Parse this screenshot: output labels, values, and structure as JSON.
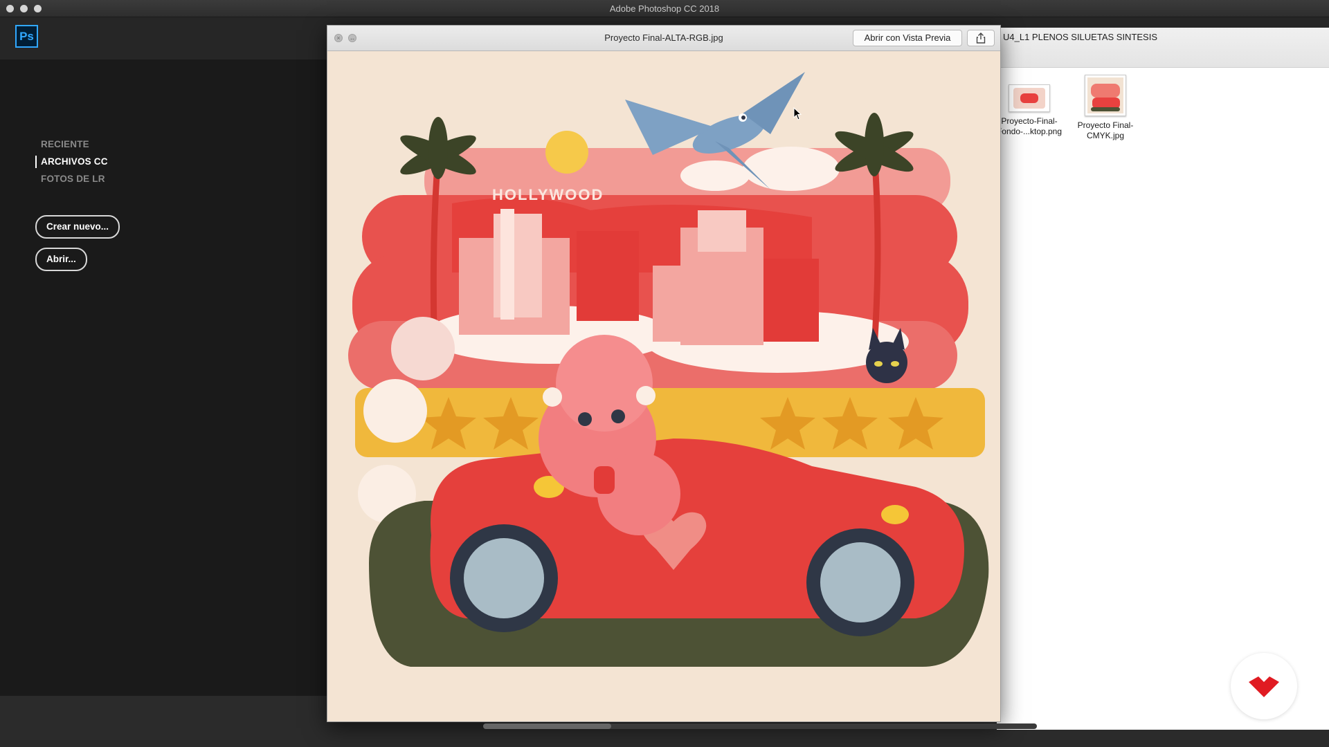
{
  "window": {
    "title": "Adobe Photoshop CC 2018"
  },
  "photoshop": {
    "logo": "Ps",
    "nav": [
      {
        "label": "RECIENTE",
        "active": false
      },
      {
        "label": "ARCHIVOS CC",
        "active": true
      },
      {
        "label": "FOTOS DE LR",
        "active": false
      }
    ],
    "create_button": "Crear nuevo...",
    "open_button": "Abrir..."
  },
  "preview": {
    "title": "Proyecto Final-ALTA-RGB.jpg",
    "open_with_button": "Abrir con Vista Previa",
    "share_icon": "share-icon",
    "artwork_text": "HOLLYWOOD"
  },
  "finder": {
    "folder_title": "U4_L1 PLENOS SILUETAS SINTESIS",
    "files": [
      {
        "name_line1": "Proyecto-Final-",
        "name_line2": "Fondo-...ktop.png"
      },
      {
        "name_line1": "Proyecto Final-",
        "name_line2": "CMYK.jpg"
      }
    ]
  },
  "colors": {
    "ps_blue": "#31a8ff",
    "artwork_bg": "#f4e4d3",
    "artwork_red": "#e8413f",
    "domestika_red": "#e01b22"
  }
}
